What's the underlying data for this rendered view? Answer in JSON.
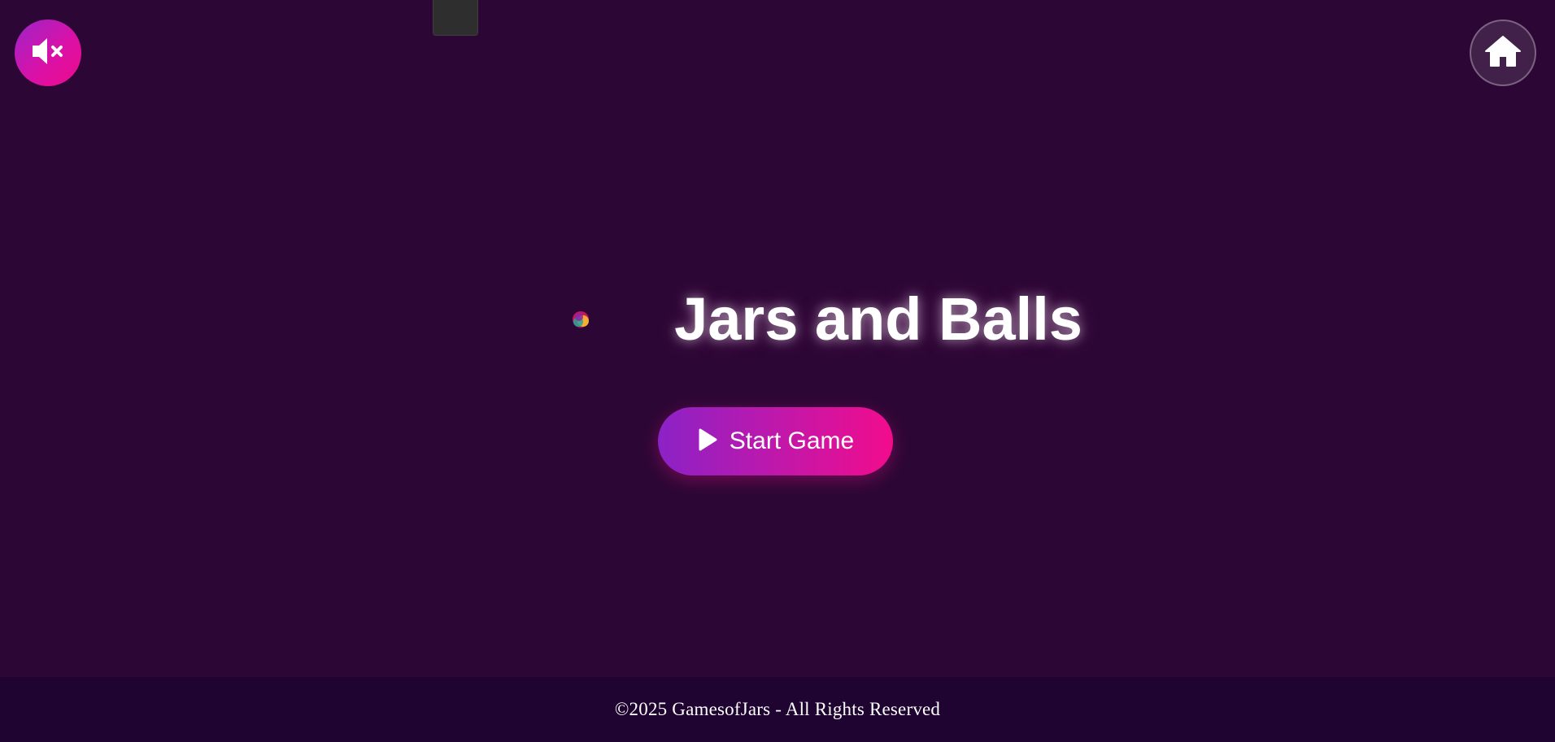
{
  "game": {
    "title": "Jars and Balls",
    "start_button_label": "Start Game"
  },
  "controls": {
    "sound_icon": "speaker-muted-icon",
    "home_icon": "home-icon",
    "play_icon": "play-icon"
  },
  "footer": {
    "copyright": "©2025 GamesofJars - All Rights Reserved"
  },
  "colors": {
    "background": "#2c0735",
    "footer_background": "#1f0330",
    "gradient_start": "#8b22c6",
    "gradient_end": "#f20c8c",
    "text": "#ffffff"
  }
}
